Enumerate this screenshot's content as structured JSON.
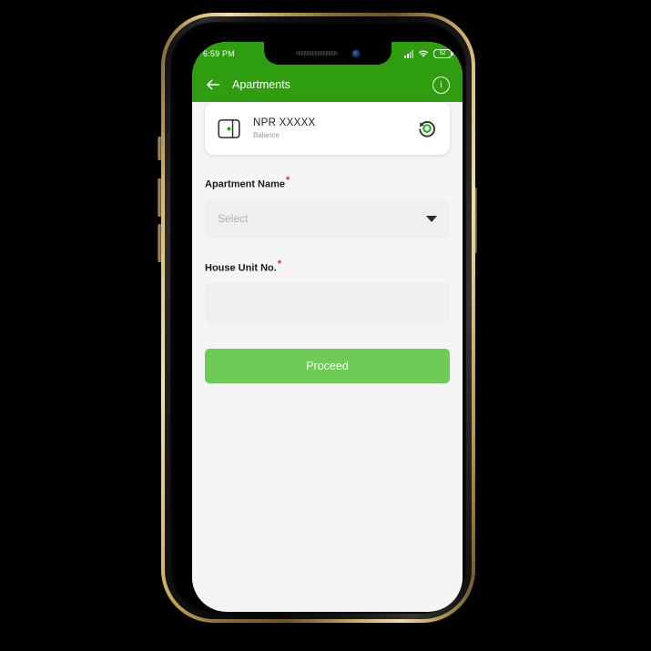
{
  "status_bar": {
    "time": "6:59 PM",
    "signal_icon": "cellular-signal-icon",
    "wifi_icon": "wifi-icon",
    "battery_level": "52"
  },
  "app_bar": {
    "back_icon": "back-arrow-icon",
    "title": "Apartments",
    "info_icon": "info-icon",
    "info_glyph": "i"
  },
  "balance_card": {
    "wallet_icon": "wallet-icon",
    "amount": "NPR XXXXX",
    "label": "Balance",
    "refresh_icon": "refresh-icon"
  },
  "form": {
    "apartment": {
      "label": "Apartment Name",
      "required_mark": "*",
      "selected_value": "Select",
      "chevron_icon": "chevron-down-icon"
    },
    "house_unit": {
      "label": "House Unit No.",
      "required_mark": "*",
      "value": "",
      "placeholder": ""
    },
    "submit_label": "Proceed"
  },
  "colors": {
    "header_green": "#2e9e0e",
    "button_green": "#6dcb56",
    "page_background": "#f5f5f5",
    "field_background": "#efefef",
    "required_red": "#e8262b"
  }
}
